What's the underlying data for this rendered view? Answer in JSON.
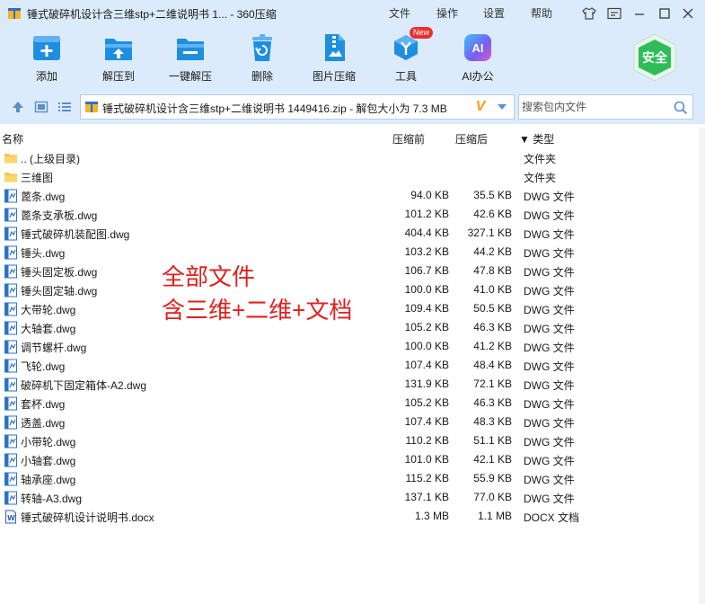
{
  "window": {
    "title": "锤式破碎机设计含三维stp+二维说明书 1... - 360压缩",
    "menu": [
      "文件",
      "操作",
      "设置",
      "帮助"
    ]
  },
  "toolbar": {
    "buttons": [
      {
        "label": "添加",
        "icon": "add-icon"
      },
      {
        "label": "解压到",
        "icon": "extract-to-icon"
      },
      {
        "label": "一键解压",
        "icon": "one-click-extract-icon"
      },
      {
        "label": "删除",
        "icon": "delete-icon"
      },
      {
        "label": "图片压缩",
        "icon": "image-compress-icon"
      },
      {
        "label": "工具",
        "icon": "tools-icon",
        "badge": "New"
      },
      {
        "label": "AI办公",
        "icon": "ai-office-icon",
        "glyph": "AI"
      }
    ],
    "safe_badge": "安全"
  },
  "address": {
    "path": "锤式破碎机设计含三维stp+二维说明书 1449416.zip - 解包大小为 7.3 MB",
    "v_glyph": "V"
  },
  "search": {
    "placeholder": "搜索包内文件"
  },
  "columns": {
    "name": "名称",
    "compressed": "压缩前",
    "size": "压缩后",
    "type": "▼ 类型"
  },
  "files": [
    {
      "name": ".. (上级目录)",
      "before": "",
      "after": "",
      "type": "文件夹",
      "kind": "folder"
    },
    {
      "name": "三维图",
      "before": "",
      "after": "",
      "type": "文件夹",
      "kind": "folder"
    },
    {
      "name": "蓖条.dwg",
      "before": "94.0 KB",
      "after": "35.5 KB",
      "type": "DWG 文件",
      "kind": "dwg"
    },
    {
      "name": "蓖条支承板.dwg",
      "before": "101.2 KB",
      "after": "42.6 KB",
      "type": "DWG 文件",
      "kind": "dwg"
    },
    {
      "name": "锤式破碎机装配图.dwg",
      "before": "404.4 KB",
      "after": "327.1 KB",
      "type": "DWG 文件",
      "kind": "dwg"
    },
    {
      "name": "锤头.dwg",
      "before": "103.2 KB",
      "after": "44.2 KB",
      "type": "DWG 文件",
      "kind": "dwg"
    },
    {
      "name": "锤头固定板.dwg",
      "before": "106.7 KB",
      "after": "47.8 KB",
      "type": "DWG 文件",
      "kind": "dwg"
    },
    {
      "name": "锤头固定轴.dwg",
      "before": "100.0 KB",
      "after": "41.0 KB",
      "type": "DWG 文件",
      "kind": "dwg"
    },
    {
      "name": "大带轮.dwg",
      "before": "109.4 KB",
      "after": "50.5 KB",
      "type": "DWG 文件",
      "kind": "dwg"
    },
    {
      "name": "大轴套.dwg",
      "before": "105.2 KB",
      "after": "46.3 KB",
      "type": "DWG 文件",
      "kind": "dwg"
    },
    {
      "name": "调节螺杆.dwg",
      "before": "100.0 KB",
      "after": "41.2 KB",
      "type": "DWG 文件",
      "kind": "dwg"
    },
    {
      "name": "飞轮.dwg",
      "before": "107.4 KB",
      "after": "48.4 KB",
      "type": "DWG 文件",
      "kind": "dwg"
    },
    {
      "name": "破碎机下固定箱体-A2.dwg",
      "before": "131.9 KB",
      "after": "72.1 KB",
      "type": "DWG 文件",
      "kind": "dwg"
    },
    {
      "name": "套杯.dwg",
      "before": "105.2 KB",
      "after": "46.3 KB",
      "type": "DWG 文件",
      "kind": "dwg"
    },
    {
      "name": "透盖.dwg",
      "before": "107.4 KB",
      "after": "48.3 KB",
      "type": "DWG 文件",
      "kind": "dwg"
    },
    {
      "name": "小带轮.dwg",
      "before": "110.2 KB",
      "after": "51.1 KB",
      "type": "DWG 文件",
      "kind": "dwg"
    },
    {
      "name": "小轴套.dwg",
      "before": "101.0 KB",
      "after": "42.1 KB",
      "type": "DWG 文件",
      "kind": "dwg"
    },
    {
      "name": "轴承座.dwg",
      "before": "115.2 KB",
      "after": "55.9 KB",
      "type": "DWG 文件",
      "kind": "dwg"
    },
    {
      "name": "转轴-A3.dwg",
      "before": "137.1 KB",
      "after": "77.0 KB",
      "type": "DWG 文件",
      "kind": "dwg"
    },
    {
      "name": "锤式破碎机设计说明书.docx",
      "before": "1.3 MB",
      "after": "1.1 MB",
      "type": "DOCX 文档",
      "kind": "docx"
    }
  ],
  "overlay": {
    "line1": "全部文件",
    "line2": "含三维+二维+文档"
  },
  "colors": {
    "toolbar_bg": "#dcebfb",
    "accent_blue": "#1e8fe0",
    "safe_green": "#2ebd59",
    "overlay_red": "#e02020"
  }
}
